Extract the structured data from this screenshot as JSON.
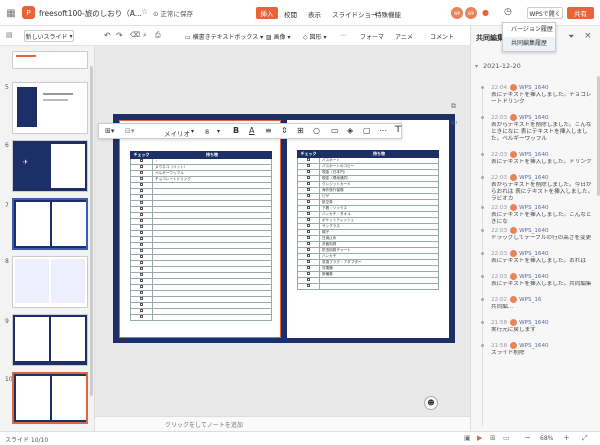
{
  "app": {
    "file_title": "freesoft100-旅のしおり（A...",
    "save_status": "正常に保存",
    "share": "共有",
    "open_in_wps": "WPSで開く"
  },
  "menu": [
    "挿入",
    "校閲",
    "表示",
    "スライドショー",
    "特殊機能"
  ],
  "menu_active": 0,
  "history_dropdown": [
    "バージョン履歴",
    "共同編集履歴"
  ],
  "toolbar": {
    "new_slide": "新しいスライド",
    "textbox": "横書きテキストボックス",
    "image": "画像",
    "shape": "図形",
    "tabs": [
      "フォーマ",
      "アニメ",
      "コメント"
    ]
  },
  "format_bar": {
    "font": "メイリオ",
    "size": "8"
  },
  "slide": {
    "left_header": [
      "チェック",
      "持ち物"
    ],
    "left_items": [
      "・",
      "ヌウネコ（ペット）",
      "ペルギーワッフル",
      "チョコレートドリンク",
      "",
      "",
      "",
      "",
      "",
      "",
      "",
      "",
      "",
      "",
      "",
      "",
      "",
      "",
      "",
      "",
      "",
      "",
      "",
      "",
      "",
      "",
      ""
    ],
    "right_header": [
      "チェック",
      "持ち物"
    ],
    "right_items": [
      "パスポート",
      "パスポートのコピー",
      "現金（日本円）",
      "現金（現地通貨）",
      "クレジットカード",
      "海外旅行保険",
      "ビザ",
      "航空券",
      "下着・ソックス",
      "ハンカチ・タオル",
      "ポケットティッシュ",
      "サングラス",
      "帽子",
      "日焼止め",
      "洗面用具",
      "防虫用剤チャート",
      "ハンカチ",
      "変換プラグ・アダプター",
      "充電器",
      "常備薬",
      "",
      ""
    ]
  },
  "thumbnails": [
    "5",
    "6",
    "7",
    "8",
    "9",
    "10"
  ],
  "right_panel": {
    "title": "共同編集履歴",
    "date": "2021-12-20",
    "entries": [
      {
        "time": "22:04",
        "user": "WPS_1640",
        "text": "表にテキストを挿入しました。チョコレートドリンク"
      },
      {
        "time": "22:03",
        "user": "WPS_1640",
        "text": "表からテキストを削除しました。こんなときになに 表にテキストを挿入しました。ベルギーワッフル"
      },
      {
        "time": "22:03",
        "user": "WPS_1640",
        "text": "表にテキストを挿入しました。ドリンク"
      },
      {
        "time": "22:03",
        "user": "WPS_1640",
        "text": "表からテキストを削除しました。今日からおれは 表にテキストを挿入しました。ラビオカ"
      },
      {
        "time": "22:03",
        "user": "WPS_1640",
        "text": "表にテキストを挿入しました。こんなときにな"
      },
      {
        "time": "22:03",
        "user": "WPS_1640",
        "text": "ドラッグしてテーブルの行の高さを変更"
      },
      {
        "time": "22:03",
        "user": "WPS_1640",
        "text": "表にテキストを挿入しました。おれは"
      },
      {
        "time": "22:03",
        "user": "WPS_1640",
        "text": "表にテキストを挿入しました。共同編集"
      },
      {
        "time": "22:02",
        "user": "WPS_16",
        "text": "共同編..."
      },
      {
        "time": "21:58",
        "user": "WPS_1640",
        "text": "実行元に戻します"
      },
      {
        "time": "21:58",
        "user": "WPS_1640",
        "text": "スライド削除"
      }
    ]
  },
  "notes_placeholder": "クリックをしてノートを追加",
  "status": {
    "slide": "スライド 10/10",
    "zoom": "68%"
  }
}
